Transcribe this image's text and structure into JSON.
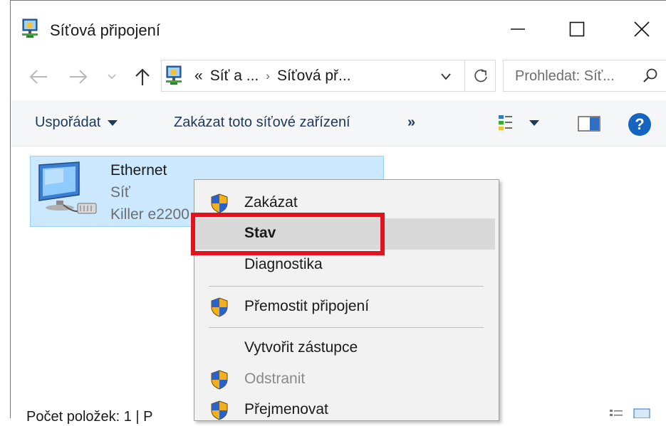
{
  "window": {
    "title": "Síťová připojení",
    "icon": "network-connections-icon"
  },
  "address_bar": {
    "prefix": "«",
    "crumbs": [
      "Síť a ...",
      "Síťová př..."
    ],
    "separator": "›"
  },
  "search": {
    "placeholder": "Prohledat: Síť..."
  },
  "command_bar": {
    "organize_label": "Uspořádat",
    "disable_label": "Zakázat toto síťové zařízení",
    "more_label": "»"
  },
  "connection": {
    "name": "Ethernet",
    "status": "Síť",
    "adapter": "Killer e2200"
  },
  "context_menu": {
    "items": [
      {
        "label": "Zakázat",
        "shield": true
      },
      {
        "label": "Stav",
        "shield": false,
        "default": true
      },
      {
        "label": "Diagnostika",
        "shield": false
      },
      {
        "label": "Přemostit připojení",
        "shield": true
      },
      {
        "label": "Vytvořit zástupce",
        "shield": false
      },
      {
        "label": "Odstranit",
        "shield": true,
        "disabled": true
      },
      {
        "label": "Přejmenovat",
        "shield": true
      }
    ]
  },
  "status_bar": {
    "text": "Počet položek: 1  |  P"
  },
  "colors": {
    "selection_bg": "#cce8ff",
    "highlight_border": "#e0141e",
    "help_blue": "#1565c0"
  }
}
